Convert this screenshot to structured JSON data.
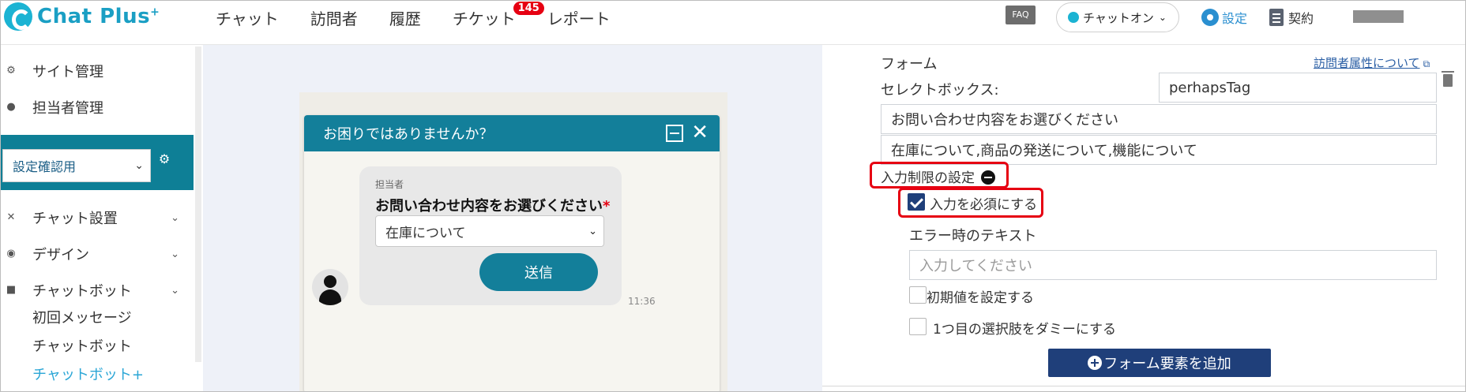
{
  "header": {
    "brand": "Chat Plus",
    "brand_sup": "+",
    "nav": [
      {
        "label": "チャット"
      },
      {
        "label": "訪問者"
      },
      {
        "label": "履歴"
      },
      {
        "label": "チケット",
        "badge": "145"
      },
      {
        "label": "レポート"
      }
    ],
    "faq": "FAQ",
    "status": "チャットオン",
    "settings": "設定",
    "contract": "契約"
  },
  "sidebar": {
    "site_admin": "サイト管理",
    "agent_admin": "担当者管理",
    "site_select": "設定確認用",
    "chat_setup": "チャット設置",
    "design": "デザイン",
    "chatbot": "チャットボット",
    "sub_items": [
      "初回メッセージ",
      "チャットボット",
      "チャットボット+"
    ]
  },
  "preview": {
    "widget_title": "お困りではありませんか？",
    "agent_label": "担当者",
    "question": "お問い合わせ内容をお選びください",
    "required_mark": "*",
    "selected_option": "在庫について",
    "send_label": "送信",
    "time": "11:36"
  },
  "form": {
    "section_label": "フォーム",
    "visitor_attr_link": "訪問者属性について",
    "selectbox_label": "セレクトボックス:",
    "tag_value": "perhapsTag",
    "question_value": "お問い合わせ内容をお選びください",
    "options_value": "在庫について,商品の発送について,機能について",
    "input_limit_label": "入力制限の設定",
    "required_checkbox_label": "入力を必須にする",
    "required_checked": true,
    "error_text_label": "エラー時のテキスト",
    "error_text_placeholder": "入力してください",
    "initial_value_label": "初期値を設定する",
    "dummy_label": "1つ目の選択肢をダミーにする",
    "add_element_label": "フォーム要素を追加"
  },
  "colors": {
    "brand": "#1a9fc4",
    "widget_header": "#137f9a",
    "primary_button": "#1f3f7a",
    "highlight": "#e60012"
  }
}
